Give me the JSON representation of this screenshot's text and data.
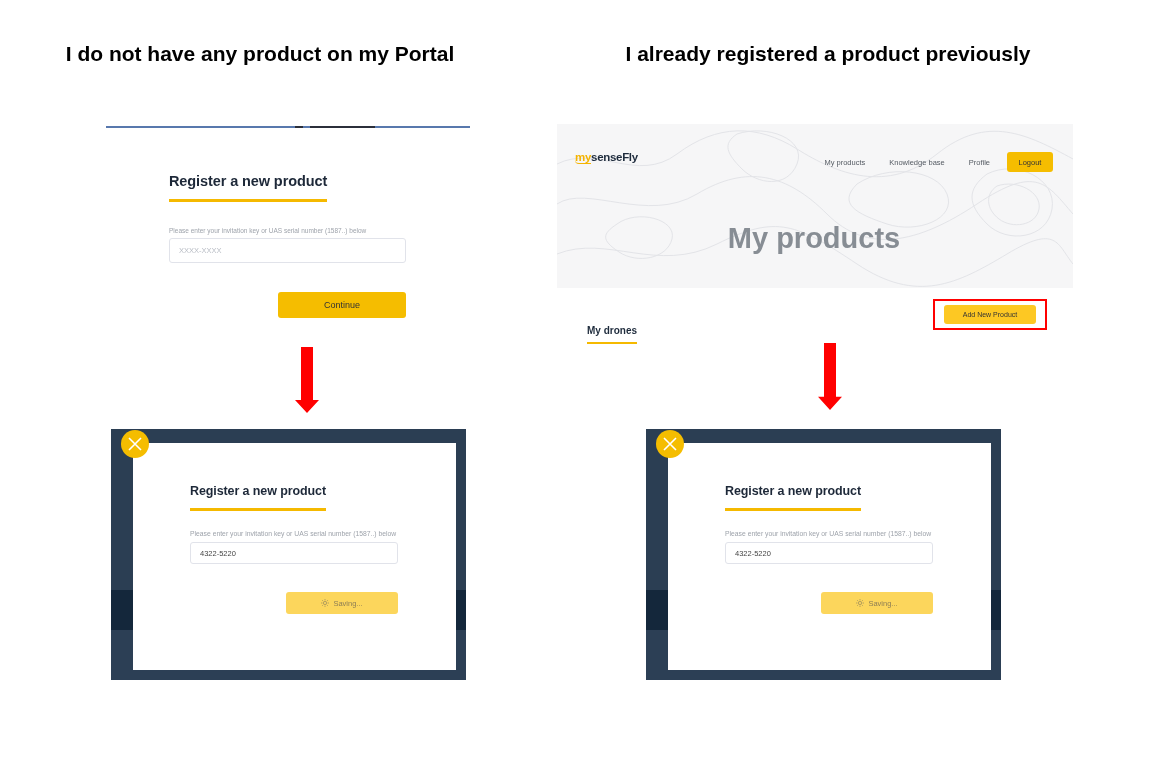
{
  "columns": [
    {
      "heading": "I do not have any product on my Portal",
      "before": {
        "kind": "form",
        "title": "Register a new product",
        "label": "Please enter your invitation key or UAS serial number (1587..) below",
        "placeholder": "XXXX-XXXX",
        "button": "Continue"
      },
      "after": {
        "title": "Register a new product",
        "label": "Please enter your invitation key or UAS serial number (1587..) below",
        "value": "4322-5220",
        "button": "Saving...",
        "busy": true
      }
    },
    {
      "heading": "I already registered a product previously",
      "before": {
        "kind": "page",
        "logo": {
          "accent": "my",
          "name": "senseFly"
        },
        "nav": [
          "My products",
          "Knowledge base",
          "Profile"
        ],
        "logout": "Logout",
        "hero_title": "My products",
        "action": {
          "label": "Add New Product",
          "highlighted": true
        },
        "section": "My drones"
      },
      "after": {
        "title": "Register a new product",
        "label": "Please enter your invitation key or UAS serial number (1587..) below",
        "value": "4322-5220",
        "button": "Saving...",
        "busy": true
      }
    }
  ]
}
